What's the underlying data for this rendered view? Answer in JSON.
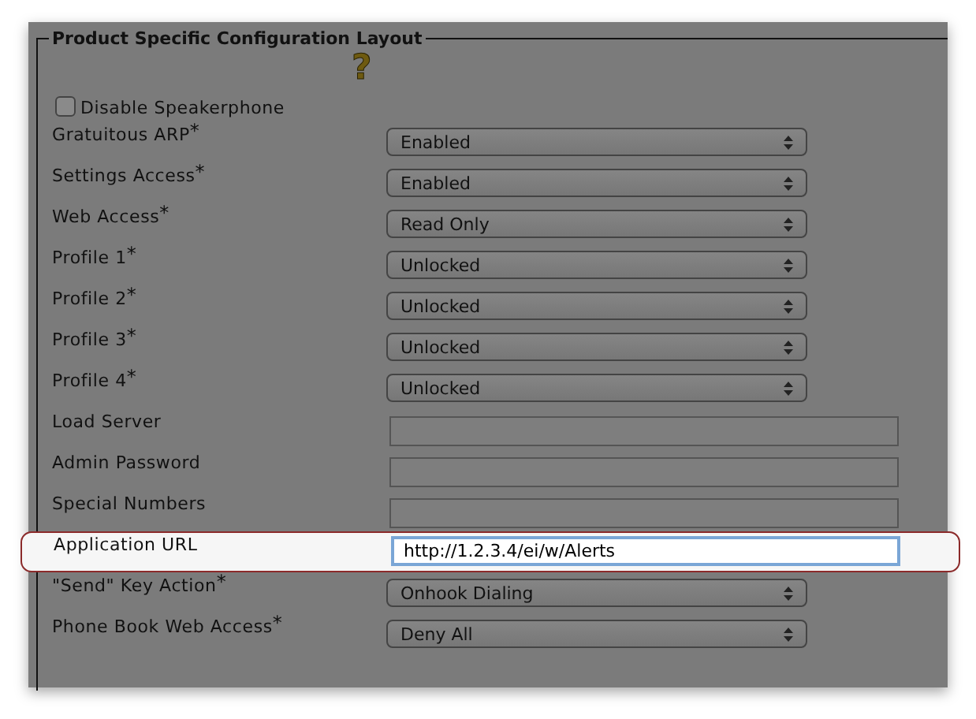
{
  "section": {
    "title": "Product Specific Configuration Layout",
    "help_icon": "?"
  },
  "rows": [
    {
      "kind": "checkbox",
      "label": "Disable Speakerphone",
      "checked": false,
      "highlighted": false
    },
    {
      "kind": "select",
      "label": "Gratuitous ARP",
      "required_mark": "*",
      "value": "Enabled",
      "highlighted": false
    },
    {
      "kind": "select",
      "label": "Settings Access",
      "required_mark": "*",
      "value": "Enabled",
      "highlighted": false
    },
    {
      "kind": "select",
      "label": "Web Access",
      "required_mark": "*",
      "value": "Read Only",
      "highlighted": false
    },
    {
      "kind": "select",
      "label": "Profile 1",
      "required_mark": "*",
      "value": "Unlocked",
      "highlighted": false
    },
    {
      "kind": "select",
      "label": "Profile 2",
      "required_mark": "*",
      "value": "Unlocked",
      "highlighted": false
    },
    {
      "kind": "select",
      "label": "Profile 3",
      "required_mark": "*",
      "value": "Unlocked",
      "highlighted": false
    },
    {
      "kind": "select",
      "label": "Profile 4",
      "required_mark": "*",
      "value": "Unlocked",
      "highlighted": false
    },
    {
      "kind": "text",
      "label": "Load Server",
      "highlighted": false
    },
    {
      "kind": "text",
      "label": "Admin Password",
      "highlighted": false
    },
    {
      "kind": "text",
      "label": "Special Numbers",
      "highlighted": false
    },
    {
      "kind": "text",
      "label": "Application URL",
      "value": "http://1.2.3.4/ei/w/Alerts",
      "highlighted": true
    },
    {
      "kind": "select",
      "label": "\"Send\" Key Action",
      "required_mark": "*",
      "value": "Onhook Dialing",
      "highlighted": false
    },
    {
      "kind": "select",
      "label": "Phone Book Web Access",
      "required_mark": "*",
      "value": "Deny All",
      "highlighted": false
    }
  ]
}
